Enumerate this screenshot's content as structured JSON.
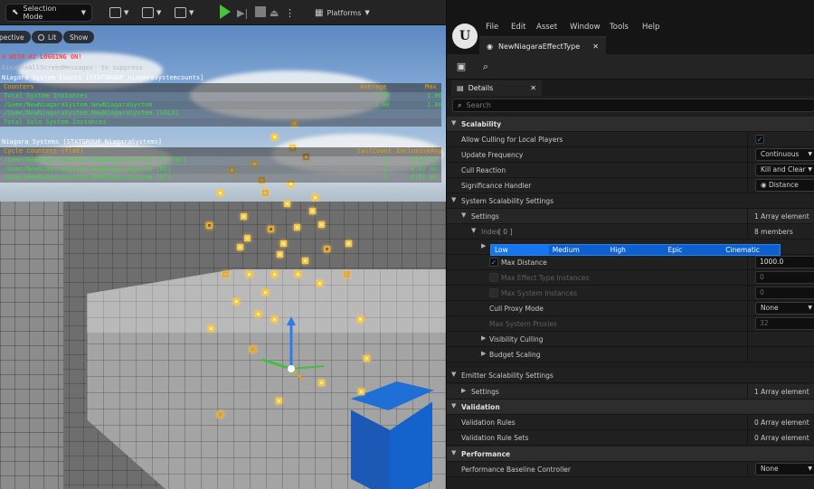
{
  "toolbar": {
    "mode_label": "Selection Mode",
    "platforms_label": "Platforms"
  },
  "viewport": {
    "buttons": {
      "perspective": "pective",
      "lit": "Lit",
      "show": "Show"
    },
    "warning": "G WITH AI LOGGING ON!",
    "suppress": "DisableAllScreenMessages' to suppress",
    "counts_title": "Niagara System Counts [STATGROUP_niagarasystemcounts]",
    "counts_header": {
      "name": "Counters",
      "avg": "Average",
      "max": "Max"
    },
    "counts_rows": [
      {
        "name": "Total System Instances",
        "avg": "1.00",
        "max": "1.00"
      },
      {
        "name": "/Game/NewNiagaraSystem.NewNiagaraSystem",
        "avg": "1.00",
        "max": "1.00"
      },
      {
        "name": "/Game/NewNiagaraSystem.NewNiagaraSystem [SOLO]",
        "avg": "",
        "max": ""
      },
      {
        "name": "Total Solo System Instances",
        "avg": "",
        "max": ""
      }
    ],
    "systems_title": "Niagara Systems [STATGROUP_NiagaraSystems]",
    "systems_header": {
      "name": "Cycle counters (flat)",
      "calls": "CallCount",
      "incl": "InclusiveAvg"
    },
    "systems_rows": [
      {
        "name": "/Game/NewNiagaraSystem.NewNiagaraSystem [GT_CNC]",
        "calls": "3",
        "incl": "0.00 ms"
      },
      {
        "name": "/Game/NewNiagaraSystem.NewNiagaraSystem [RT]",
        "calls": "1",
        "incl": "0.02 ms"
      },
      {
        "name": "/Game/NewNiagaraSystem.NewNiagaraSystem [GT]",
        "calls": "5",
        "incl": "0.01 ms"
      }
    ]
  },
  "menu": [
    "File",
    "Edit",
    "Asset",
    "Window",
    "Tools",
    "Help"
  ],
  "document_tab": "NewNiagaraEffectType",
  "details": {
    "tab_label": "Details",
    "search_placeholder": "Search",
    "sections": {
      "scalability": "Scalability",
      "validation": "Validation",
      "performance": "Performance"
    },
    "rows": {
      "allow_culling": "Allow Culling for Local Players",
      "update_frequency": "Update Frequency",
      "update_frequency_value": "Continuous",
      "cull_reaction": "Cull Reaction",
      "cull_reaction_value": "Kill and Clear",
      "significance_handler": "Significance Handler",
      "significance_handler_value": "Distance",
      "system_scalability": "System Scalability Settings",
      "settings": "Settings",
      "settings_value": "1 Array element",
      "index": "Index",
      "index_num": "[ 0 ]",
      "index_members": "8 members",
      "quality_levels": [
        "Low",
        "Medium",
        "High",
        "Epic",
        "Cinematic"
      ],
      "max_distance": "Max Distance",
      "max_distance_value": "1000.0",
      "max_effect_instances": "Max Effect Type Instances",
      "max_effect_instances_value": "0",
      "max_system_instances": "Max System Instances",
      "max_system_instances_value": "0",
      "cull_proxy_mode": "Cull Proxy Mode",
      "cull_proxy_mode_value": "None",
      "max_system_proxies": "Max System Proxies",
      "max_system_proxies_value": "32",
      "visibility_culling": "Visibility Culling",
      "budget_scaling": "Budget Scaling",
      "emitter_scalability": "Emitter Scalability Settings",
      "emitter_settings": "Settings",
      "emitter_settings_value": "1 Array element",
      "validation_rules": "Validation Rules",
      "validation_rules_value": "0 Array element",
      "validation_rule_sets": "Validation Rule Sets",
      "validation_rule_sets_value": "0 Array element",
      "perf_baseline": "Performance Baseline Controller",
      "perf_baseline_value": "None"
    }
  },
  "colors": {
    "stat_green": "#3fdc3f",
    "stat_orange": "#f0a000",
    "accent_blue": "#1576f0",
    "play_green": "#4ac13a"
  }
}
